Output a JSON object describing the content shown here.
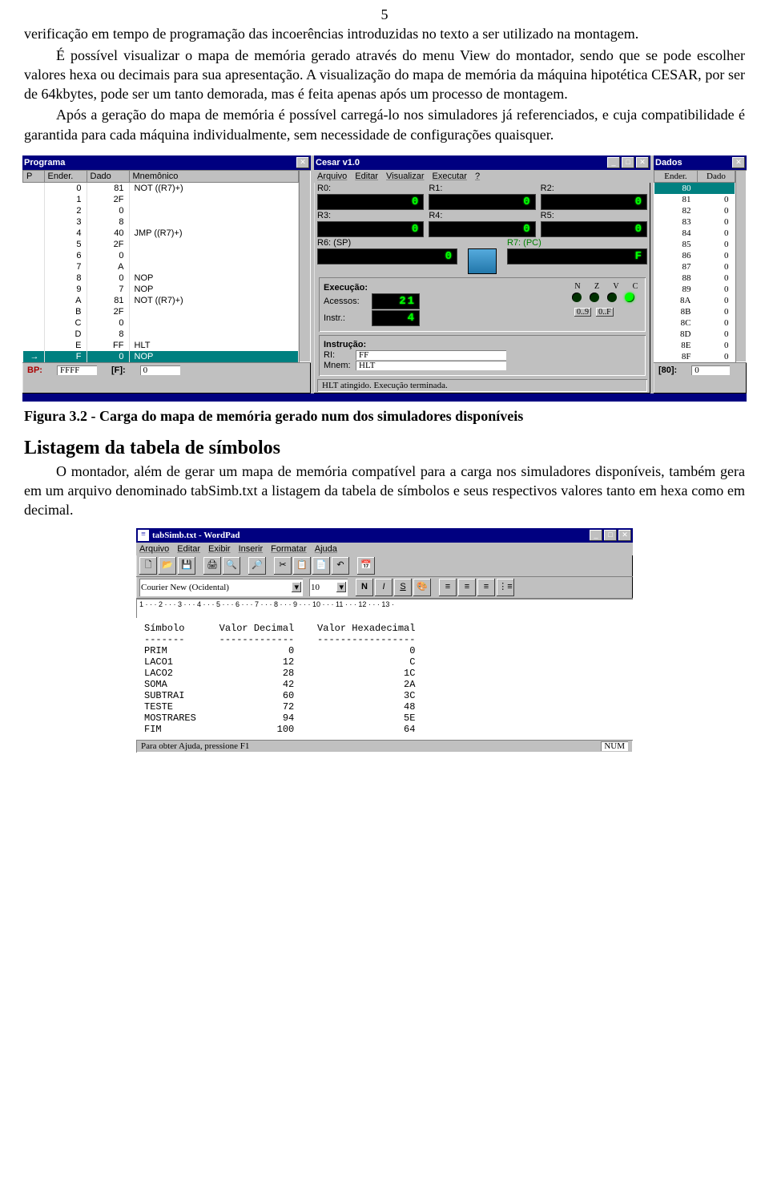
{
  "pagenum": "5",
  "para1": "verificação em tempo de programação das incoerências introduzidas no texto a ser utilizado na montagem.",
  "para2": "É possível visualizar o mapa de memória gerado através do menu View do montador, sendo que se pode escolher valores hexa ou decimais para sua apresentação. A visualização do mapa de memória da máquina hipotética CESAR, por ser de 64kbytes, pode ser um tanto demorada, mas é feita apenas após um processo de montagem.",
  "para3": "Após a geração do mapa de memória é possível carregá-lo nos simuladores já referenciados, e cuja compatibilidade é garantida para cada máquina individualmente, sem necessidade de configurações quaisquer.",
  "figcap": "Figura 3.2 - Carga do mapa de memória gerado num dos simuladores disponíveis",
  "h2": "Listagem da tabela de símbolos",
  "para4": "O montador, além de gerar um mapa de memória compatível para a carga nos simuladores disponíveis, também gera em um arquivo denominado tabSimb.txt a listagem da tabela de símbolos e seus respectivos valores tanto em hexa como em decimal.",
  "programa": {
    "title": "Programa",
    "cols": [
      "P",
      "Ender.",
      "Dado",
      "Mnemônico"
    ],
    "rows": [
      {
        "e": "0",
        "d": "81",
        "m": "NOT ((R7)+)"
      },
      {
        "e": "1",
        "d": "2F",
        "m": ""
      },
      {
        "e": "2",
        "d": "0",
        "m": ""
      },
      {
        "e": "3",
        "d": "8",
        "m": ""
      },
      {
        "e": "4",
        "d": "40",
        "m": "JMP ((R7)+)"
      },
      {
        "e": "5",
        "d": "2F",
        "m": ""
      },
      {
        "e": "6",
        "d": "0",
        "m": ""
      },
      {
        "e": "7",
        "d": "A",
        "m": ""
      },
      {
        "e": "8",
        "d": "0",
        "m": "NOP"
      },
      {
        "e": "9",
        "d": "7",
        "m": "NOP"
      },
      {
        "e": "A",
        "d": "81",
        "m": "NOT ((R7)+)"
      },
      {
        "e": "B",
        "d": "2F",
        "m": ""
      },
      {
        "e": "C",
        "d": "0",
        "m": ""
      },
      {
        "e": "D",
        "d": "8",
        "m": ""
      },
      {
        "e": "E",
        "d": "FF",
        "m": "HLT"
      },
      {
        "e": "F",
        "d": "0",
        "m": "NOP",
        "sel": true
      }
    ],
    "bp_label": "BP:",
    "bp_val": "FFFF",
    "f_label": "[F]:",
    "f_val": "0"
  },
  "cesar": {
    "title": "Cesar v1.0",
    "menu": [
      "Arquivo",
      "Editar",
      "Visualizar",
      "Executar",
      "?"
    ],
    "regs": {
      "R0": "0",
      "R1": "0",
      "R2": "0",
      "R3": "0",
      "R4": "0",
      "R5": "0"
    },
    "sp_label": "R6: (SP)",
    "sp": "0",
    "pc_label": "R7: (PC)",
    "pc": "F",
    "exec_label": "Execução:",
    "acessos_label": "Acessos:",
    "acessos": "21",
    "instr_label": "Instr.:",
    "instr": "4",
    "flags": [
      "N",
      "Z",
      "V",
      "C"
    ],
    "flag_state": [
      false,
      false,
      false,
      true
    ],
    "btn09": "0..9",
    "btn0F": "0..F",
    "instrucao_label": "Instrução:",
    "ri_label": "RI:",
    "ri": "FF",
    "mnem_label": "Mnem:",
    "mnem": "HLT",
    "status": "HLT atingido. Execução terminada."
  },
  "dados": {
    "title": "Dados",
    "cols": [
      "Ender.",
      "Dado"
    ],
    "rows": [
      {
        "e": "80",
        "d": "",
        "sel": true
      },
      {
        "e": "81",
        "d": "0"
      },
      {
        "e": "82",
        "d": "0"
      },
      {
        "e": "83",
        "d": "0"
      },
      {
        "e": "84",
        "d": "0"
      },
      {
        "e": "85",
        "d": "0"
      },
      {
        "e": "86",
        "d": "0"
      },
      {
        "e": "87",
        "d": "0"
      },
      {
        "e": "88",
        "d": "0"
      },
      {
        "e": "89",
        "d": "0"
      },
      {
        "e": "8A",
        "d": "0"
      },
      {
        "e": "8B",
        "d": "0"
      },
      {
        "e": "8C",
        "d": "0"
      },
      {
        "e": "8D",
        "d": "0"
      },
      {
        "e": "8E",
        "d": "0"
      },
      {
        "e": "8F",
        "d": "0"
      }
    ],
    "foot_label": "[80]:",
    "foot_val": "0"
  },
  "wordpad": {
    "title": "tabSimb.txt - WordPad",
    "menu": [
      "Arquivo",
      "Editar",
      "Exibir",
      "Inserir",
      "Formatar",
      "Ajuda"
    ],
    "font": "Courier New (Ocidental)",
    "size": "10",
    "ruler": "1 · · · 2 · · · 3 · · · 4 · · · 5 · · · 6 · · · 7 · · · 8 · · · 9 · · · 10 · · · 11 · · · 12 · · · 13 ·",
    "header": "Símbolo      Valor Decimal    Valor Hexadecimal",
    "divider": "-------      -------------    -----------------",
    "rows": [
      {
        "s": "PRIM",
        "d": "0",
        "h": "0"
      },
      {
        "s": "LACO1",
        "d": "12",
        "h": "C"
      },
      {
        "s": "LACO2",
        "d": "28",
        "h": "1C"
      },
      {
        "s": "SOMA",
        "d": "42",
        "h": "2A"
      },
      {
        "s": "SUBTRAI",
        "d": "60",
        "h": "3C"
      },
      {
        "s": "TESTE",
        "d": "72",
        "h": "48"
      },
      {
        "s": "MOSTRARES",
        "d": "94",
        "h": "5E"
      },
      {
        "s": "FIM",
        "d": "100",
        "h": "64"
      }
    ],
    "status": "Para obter Ajuda, pressione F1",
    "num": "NUM"
  }
}
